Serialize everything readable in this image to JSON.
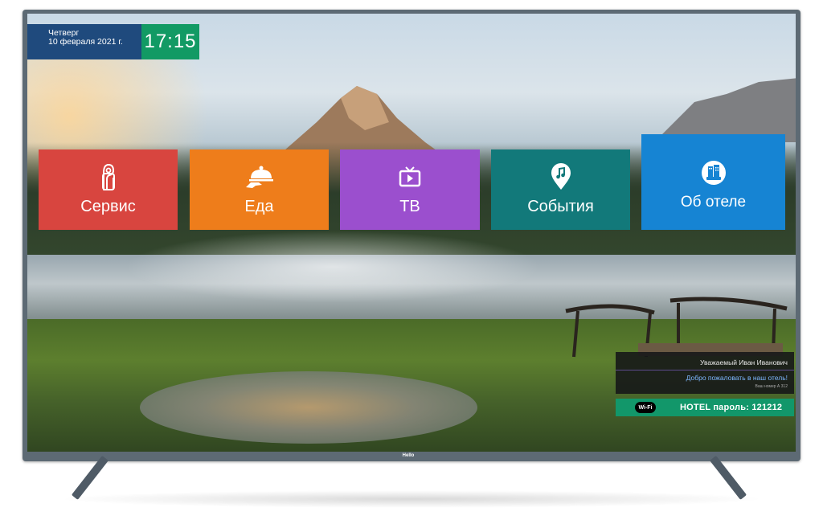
{
  "datetime": {
    "day": "Четверг",
    "date": "10 февраля 2021 г.",
    "time": "17:15"
  },
  "tiles": [
    {
      "label": "Сервис",
      "icon": "door-hanger-icon",
      "color": "#d8453f"
    },
    {
      "label": "Еда",
      "icon": "cloche-icon",
      "color": "#ee7d1b"
    },
    {
      "label": "ТВ",
      "icon": "tv-icon",
      "color": "#9b4fce"
    },
    {
      "label": "События",
      "icon": "music-pin-icon",
      "color": "#12797a"
    },
    {
      "label": "Об отеле",
      "icon": "hotel-icon",
      "color": "#1684d3"
    }
  ],
  "greeting": {
    "name": "Уважаемый Иван Иванович",
    "welcome": "Добро пожаловать в наш отель!",
    "room": "Ваш номер А 312"
  },
  "wifi": {
    "logo": "Wi-Fi",
    "text": "HOTEL пароль: 121212"
  },
  "brand": "Hello"
}
